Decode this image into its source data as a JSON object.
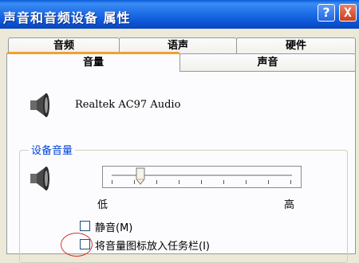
{
  "window": {
    "title": "声音和音频设备 属性",
    "help_button": "?",
    "close_button": "X"
  },
  "tabs": {
    "row1": [
      "音频",
      "语声",
      "硬件"
    ],
    "row2": [
      "音量",
      "声音"
    ],
    "active": "音量"
  },
  "device": {
    "name": "Realtek AC97 Audio",
    "icon": "speaker-icon"
  },
  "device_volume": {
    "group_title": "设备音量",
    "icon": "speaker-icon",
    "slider": {
      "low_label": "低",
      "high_label": "高",
      "level": 0.16
    },
    "mute_label": "静音(M)",
    "mute_checked": false,
    "tray_label": "将音量图标放入任务栏(I)",
    "tray_checked": false
  },
  "colors": {
    "accent": "#0046d5",
    "titlebar": "#0b53d4",
    "highlight": "#e03030"
  }
}
